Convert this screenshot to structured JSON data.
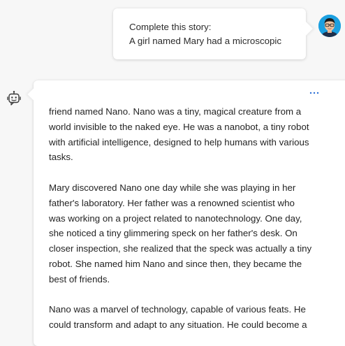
{
  "user_message": {
    "lines": [
      "Complete this story:",
      "A girl named Mary had a microscopic"
    ]
  },
  "bot_message": {
    "more_icon": "more-horizontal-icon",
    "paragraphs": [
      {
        "lines": [
          "friend named Nano. Nano was a tiny, magical creature from a",
          "world invisible to the naked eye. He was a nanobot, a tiny robot",
          "with artificial intelligence, designed to help humans with various",
          "tasks."
        ]
      },
      {
        "lines": [
          "Mary discovered Nano one day while she was playing in her",
          "father's laboratory. Her father was a renowned scientist who",
          "was working on a project related to nanotechnology. One day,",
          "she noticed a tiny glimmering speck on her father's desk. On",
          "closer inspection, she realized that the speck was actually a tiny",
          "robot. She named him Nano and since then, they became the",
          "best of friends."
        ]
      },
      {
        "lines": [
          "Nano was a marvel of technology, capable of various feats. He",
          "could transform and adapt to any situation. He could become a"
        ]
      }
    ]
  },
  "colors": {
    "background": "#f7f7f7",
    "card": "#ffffff",
    "accent": "#2b6fd6",
    "text": "#242424"
  }
}
